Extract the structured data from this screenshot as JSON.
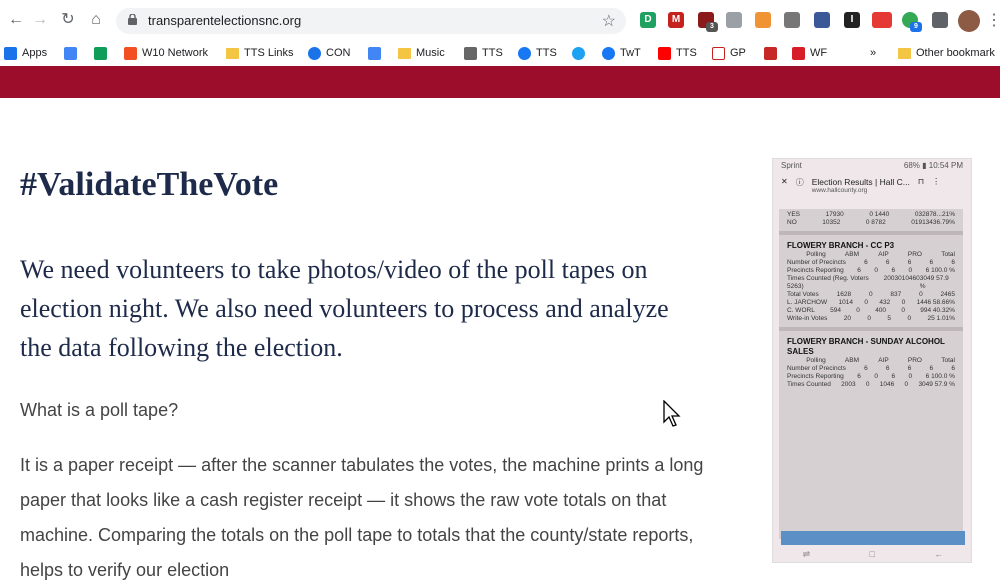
{
  "browser": {
    "url": "transparentelectionsnc.org",
    "extension_badges": [
      "3",
      "9"
    ],
    "bookmarks": [
      {
        "label": "Apps",
        "icon": "apps-grid-icon"
      },
      {
        "label": "",
        "icon": "google-icon"
      },
      {
        "label": "",
        "icon": "drive-icon"
      },
      {
        "label": "W10 Network",
        "icon": "windows-icon"
      },
      {
        "label": "TTS Links",
        "icon": "folder-icon"
      },
      {
        "label": "CON",
        "icon": "account-icon"
      },
      {
        "label": "",
        "icon": "calendar-icon"
      },
      {
        "label": "Music",
        "icon": "folder-icon"
      },
      {
        "label": "TTS",
        "icon": "page-icon"
      },
      {
        "label": "TTS",
        "icon": "facebook-icon"
      },
      {
        "label": "",
        "icon": "twitter-icon"
      },
      {
        "label": "TwT",
        "icon": "facebook-icon"
      },
      {
        "label": "TTS",
        "icon": "youtube-icon"
      },
      {
        "label": "GP",
        "icon": "gmail-icon"
      },
      {
        "label": "",
        "icon": "tool-icon"
      },
      {
        "label": "WF",
        "icon": "wf-icon"
      },
      {
        "label": "»",
        "icon": ""
      },
      {
        "label": "Other bookmark",
        "icon": "folder-icon"
      }
    ]
  },
  "page": {
    "title": "#ValidateTheVote",
    "lead": "We need volunteers to take photos/video of the poll tapes on election night. We also need volunteers to process and analyze the data following the election.",
    "question": "What is a poll tape?",
    "body": "It is a paper receipt — after the scanner tabulates the votes, the machine prints a long paper that looks like a cash register receipt — it shows the raw vote totals on that machine. Comparing the totals on the poll tape to totals that the county/state reports, helps to verify our election"
  },
  "phone": {
    "carrier": "Sprint",
    "status_right": "68% ▮ 10:54 PM",
    "app_title": "Election Results | Hall C...",
    "app_sub": "www.hallcounty.org",
    "top_rows": [
      [
        "YES",
        "17930",
        "0 1440",
        "032878...21%"
      ],
      [
        "NO",
        "10352",
        "0 8782",
        "01913436.79%"
      ]
    ],
    "section1_title": "FLOWERY BRANCH - CC P3",
    "section1_rows": [
      [
        "",
        "Polling",
        "ABM",
        "AIP",
        "PRO",
        "Total"
      ],
      [
        "Number of Precincts",
        "6",
        "6",
        "6",
        "6",
        "6"
      ],
      [
        "Precincts Reporting",
        "6",
        "0",
        "6",
        "0",
        "6  100.0 %"
      ],
      [
        "Times Counted (Reg. Voters 5263)",
        "2003",
        "0",
        "1046",
        "0",
        "3049  57.9 %"
      ],
      [
        "Total Votes",
        "1628",
        "0",
        "837",
        "0",
        "2465"
      ],
      [
        "L. JARCHOW",
        "1014",
        "0",
        "432",
        "0",
        "1446  58.66%"
      ],
      [
        "C. WORL",
        "594",
        "0",
        "400",
        "0",
        "994  40.32%"
      ],
      [
        "Write-in Votes",
        "20",
        "0",
        "5",
        "0",
        "25  1.01%"
      ]
    ],
    "section2_title": "FLOWERY BRANCH - SUNDAY ALCOHOL SALES",
    "section2_rows": [
      [
        "",
        "Polling",
        "ABM",
        "AIP",
        "PRO",
        "Total"
      ],
      [
        "Number of Precincts",
        "6",
        "6",
        "6",
        "6",
        "6"
      ],
      [
        "Precincts Reporting",
        "6",
        "0",
        "6",
        "0",
        "6  100.0 %"
      ],
      [
        "Times Counted",
        "2003",
        "0",
        "1046",
        "0",
        "3049  57.9 %"
      ]
    ]
  },
  "colors": {
    "band": "#9b0d2b",
    "heading": "#1e2a4a",
    "text": "#444444"
  }
}
